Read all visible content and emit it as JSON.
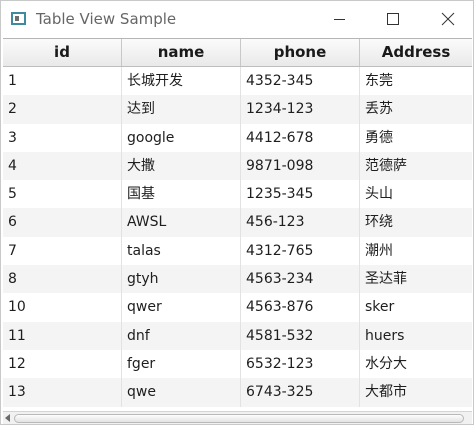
{
  "window": {
    "title": "Table View Sample"
  },
  "table": {
    "columns": [
      "id",
      "name",
      "phone",
      "Address"
    ],
    "rows": [
      [
        "1",
        "长城开发",
        "4352-345",
        "东莞"
      ],
      [
        "2",
        "达到",
        "1234-123",
        "丢苏"
      ],
      [
        "3",
        "google",
        "4412-678",
        "勇德"
      ],
      [
        "4",
        "大撒",
        "9871-098",
        "范德萨"
      ],
      [
        "5",
        "国基",
        "1235-345",
        "头山"
      ],
      [
        "6",
        "AWSL",
        "456-123",
        "环绕"
      ],
      [
        "7",
        "talas",
        "4312-765",
        "潮州"
      ],
      [
        "8",
        "gtyh",
        "4563-234",
        "圣达菲"
      ],
      [
        "10",
        "qwer",
        "4563-876",
        "sker"
      ],
      [
        "11",
        "dnf",
        "4581-532",
        "huers"
      ],
      [
        "12",
        "fger",
        "6532-123",
        "水分大"
      ],
      [
        "13",
        "qwe",
        "6743-325",
        "大都市"
      ]
    ]
  },
  "icons": {
    "app": "window-icon",
    "minimize": "minimize-icon",
    "maximize": "maximize-icon",
    "close": "close-icon",
    "scroll_left": "chevron-left-icon"
  }
}
